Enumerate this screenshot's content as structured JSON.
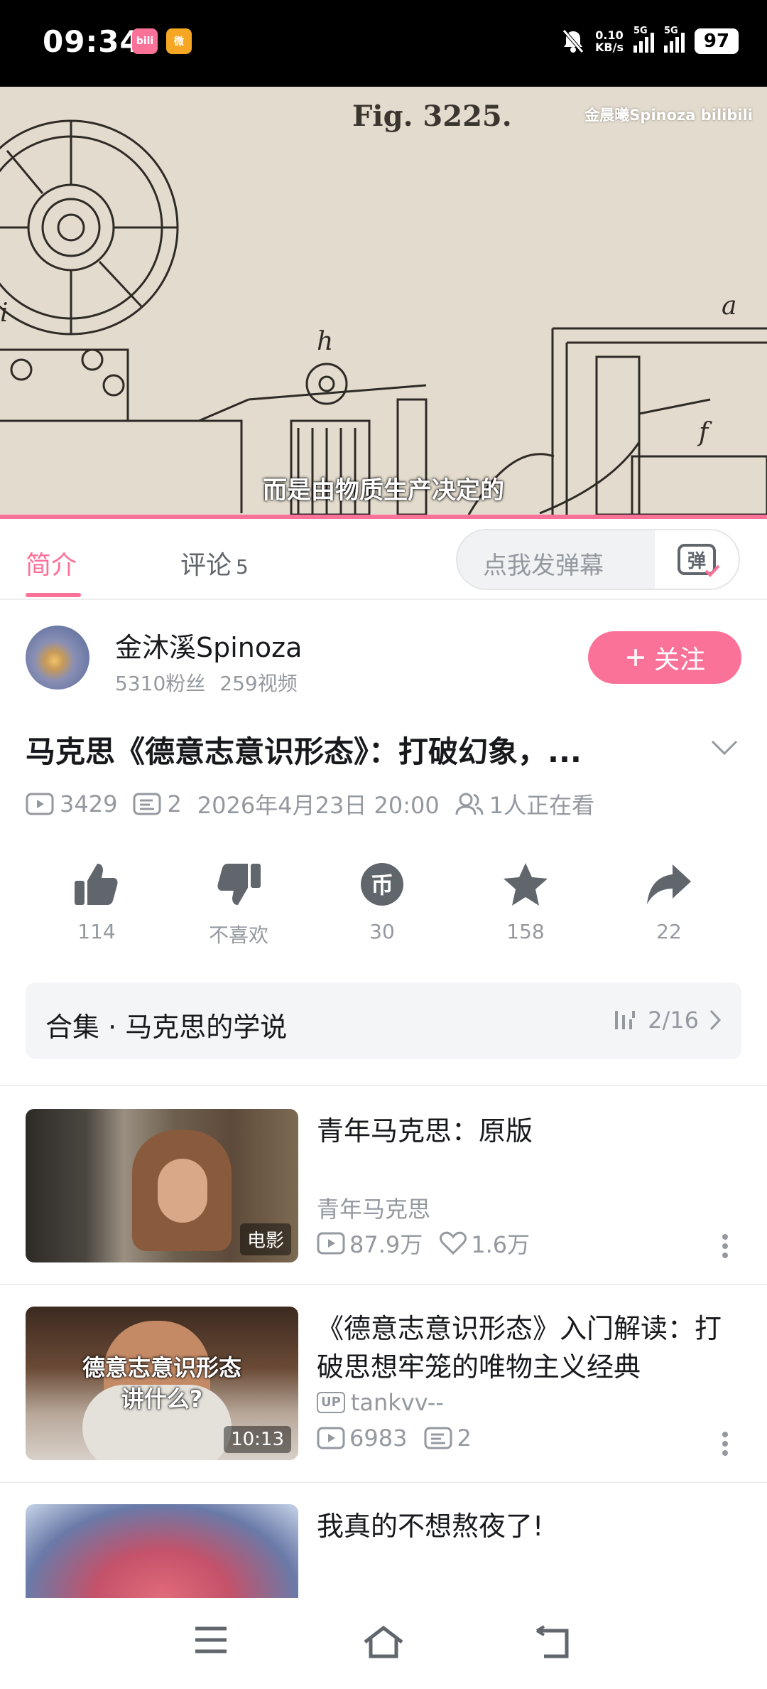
{
  "status_bar": {
    "time": "09:34",
    "net_speed_value": "0.10",
    "net_speed_unit": "KB/s",
    "sim1_label": "5G",
    "sim2_label": "5G",
    "battery": "97"
  },
  "video": {
    "figure_label": "Fig. 3225.",
    "watermark": "金晨曦Spinoza bilibili",
    "subtitle": "而是由物质生产决定的"
  },
  "tabs": {
    "intro_label": "简介",
    "comments_label": "评论",
    "comments_count": "5",
    "danmaku_placeholder": "点我发弹幕",
    "danmaku_button": "弹"
  },
  "author": {
    "name": "金沐溪Spinoza",
    "followers": "5310粉丝",
    "videos": "259视频",
    "follow_label": "关注"
  },
  "video_info": {
    "title": "马克思《德意志意识形态》：打破幻象，...",
    "views": "3429",
    "danmaku_count": "2",
    "publish_time": "2026年4月23日 20:00",
    "watching": "1人正在看"
  },
  "actions": {
    "like": "114",
    "dislike": "不喜欢",
    "coin": "30",
    "favorite": "158",
    "share": "22"
  },
  "collection": {
    "name": "合集 · 马克思的学说",
    "progress": "2/16"
  },
  "related": [
    {
      "title": "青年马克思：原版",
      "tag": "电影",
      "subtitle": "青年马克思",
      "views": "87.9万",
      "likes": "1.6万"
    },
    {
      "title": "《德意志意识形态》入门解读：打破思想牢笼的唯物主义经典",
      "thumb_text_line1": "德意志意识形态",
      "thumb_text_line2": "讲什么?",
      "duration": "10:13",
      "uploader_badge": "UP",
      "uploader": "tankvv--",
      "views": "6983",
      "danmaku": "2"
    },
    {
      "title": "我真的不想熬夜了!"
    }
  ],
  "colors": {
    "accent": "#fb7299",
    "text_secondary": "#9499a0",
    "icon_gray": "#61666d"
  }
}
